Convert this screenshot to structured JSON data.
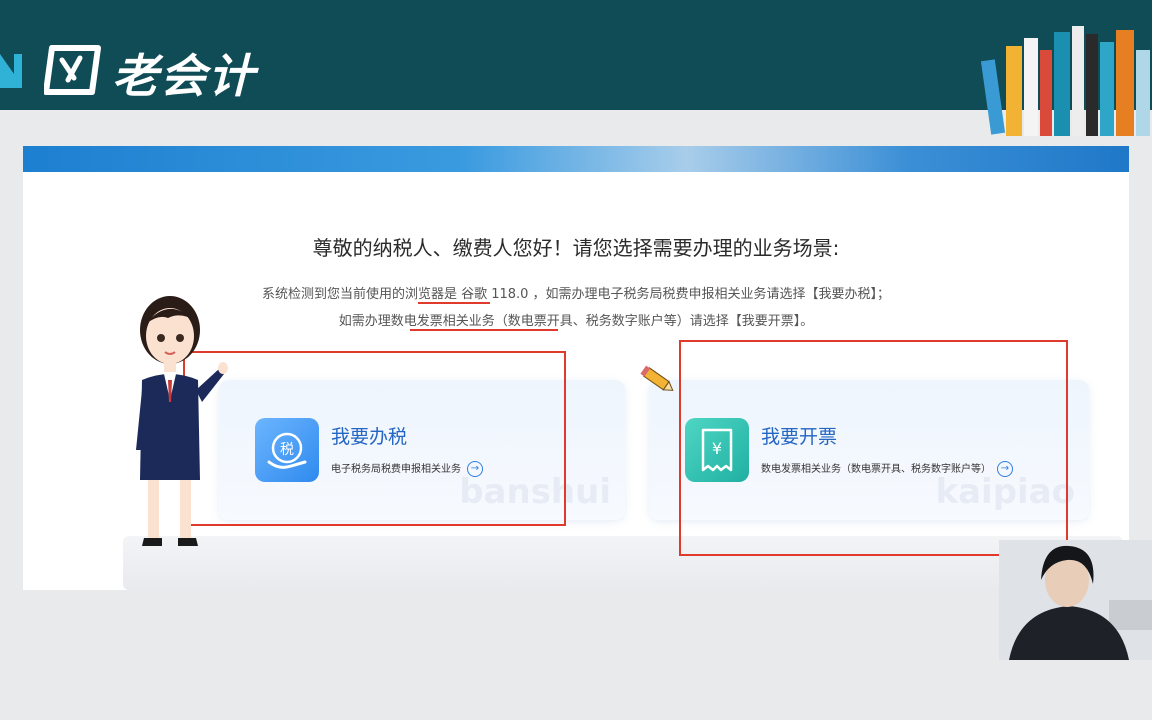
{
  "header": {
    "brand": "老会计",
    "logo_icon": "logo-icon",
    "background": "#0f4c56"
  },
  "page": {
    "greeting": "尊敬的纳税人、缴费人您好！请您选择需要办理的业务场景:",
    "detect_line1": "系统检测到您当前使用的浏览器是 谷歌 118.0 ，如需办理电子税务局税费申报相关业务请选择【我要办税】；",
    "detect_line2": "如需办理数电发票相关业务（数电票开具、税务数字账户等）请选择【我要开票】。"
  },
  "cards": [
    {
      "title": "我要办税",
      "desc": "电子税务局税费申报相关业务",
      "icon": "tax-icon",
      "watermark": "banshui",
      "accent": "#2466c4"
    },
    {
      "title": "我要开票",
      "desc": "数电发票相关业务（数电票开具、税务数字账户等）",
      "icon": "invoice-icon",
      "watermark": "kaipiao",
      "accent": "#1fb0a2"
    }
  ],
  "annotation_color": "#e03a2c"
}
